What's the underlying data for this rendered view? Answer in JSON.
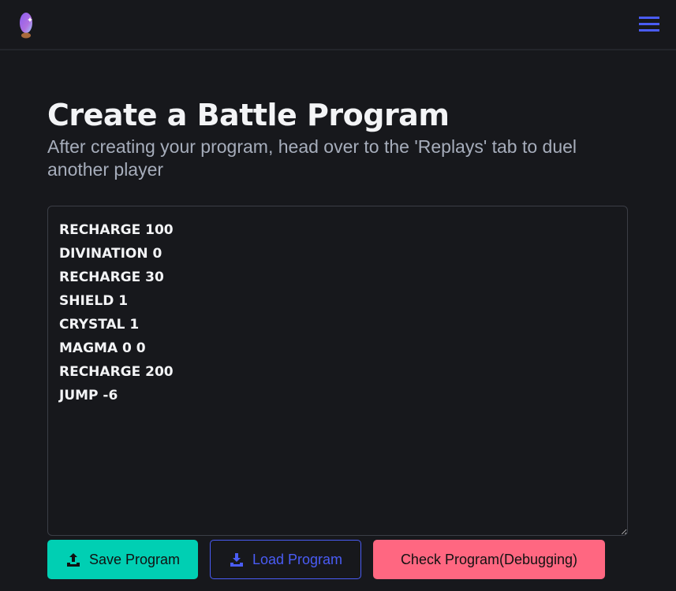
{
  "header": {
    "logo_icon": "crystal-ball-icon",
    "menu_icon": "hamburger-menu-icon",
    "accent": "#4a5cf5"
  },
  "main": {
    "title": "Create a Battle Program",
    "subtitle": "After creating your program, head over to the 'Replays' tab to duel another player",
    "program": "RECHARGE 100\nDIVINATION 0\nRECHARGE 30\nSHIELD 1\nCRYSTAL 1\nMAGMA 0 0\nRECHARGE 200\nJUMP -6",
    "buttons": {
      "save": "Save Program",
      "load": "Load Program",
      "check": "Check Program(Debugging)"
    }
  }
}
